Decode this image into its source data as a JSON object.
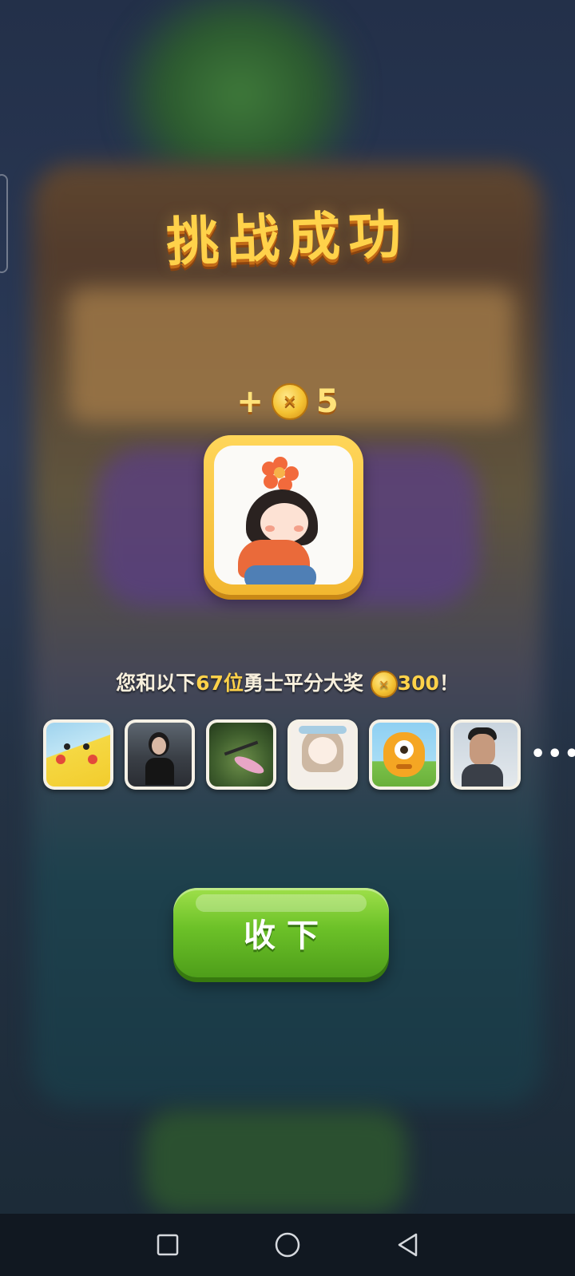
{
  "dialog": {
    "title": "挑战成功",
    "reward_prefix": "+",
    "reward_amount": "5",
    "share_text_before": "您和以下",
    "share_count": "67位",
    "share_text_middle": "勇士平分大奖",
    "share_amount": "300",
    "share_text_end": "！",
    "more_indicator": "•••",
    "accept_button_label": "收下"
  },
  "participants": [
    {
      "name": "participant-1",
      "icon": "pikachu-avatar"
    },
    {
      "name": "participant-2",
      "icon": "woman-photo-avatar"
    },
    {
      "name": "participant-3",
      "icon": "dragonfly-avatar"
    },
    {
      "name": "participant-4",
      "icon": "anime-girl-avatar"
    },
    {
      "name": "participant-5",
      "icon": "orange-monster-avatar"
    },
    {
      "name": "participant-6",
      "icon": "man-photo-avatar"
    }
  ],
  "colors": {
    "title": "#ffd24a",
    "highlight": "#ffd24a",
    "button_green": "#6cc128",
    "coin_gold": "#f4c232"
  },
  "nav": {
    "recents_icon": "square-icon",
    "home_icon": "circle-icon",
    "back_icon": "triangle-back-icon"
  }
}
